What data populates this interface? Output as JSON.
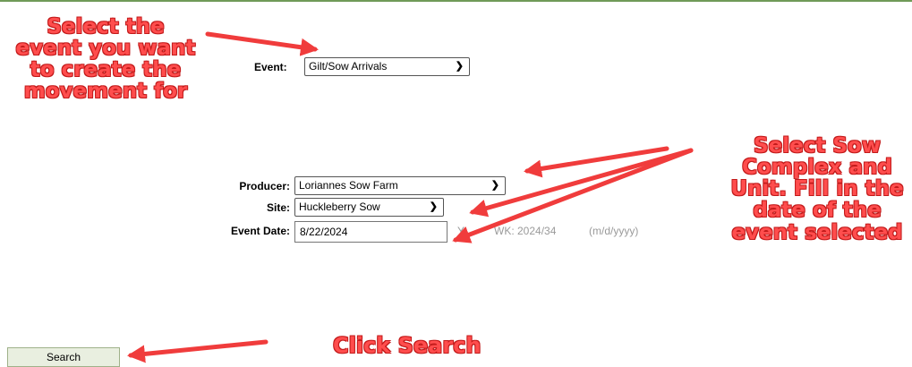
{
  "form": {
    "event_label": "Event:",
    "event_value": "Gilt/Sow Arrivals",
    "producer_label": "Producer:",
    "producer_value": "Loriannes Sow Farm",
    "site_label": "Site:",
    "site_value": "Huckleberry Sow",
    "event_date_label": "Event Date:",
    "event_date_value": "8/22/2024",
    "yearweek_prefix": "Y",
    "yearweek_value": "WK: 2024/34",
    "date_format_hint": "(m/d/yyyy)",
    "search_label": "Search"
  },
  "annotations": {
    "select_event": [
      "Select the",
      "event you want",
      "to create the",
      "movement for"
    ],
    "select_sow": [
      "Select Sow",
      "Complex and",
      "Unit. Fill in the",
      "date of the",
      "event selected"
    ],
    "click_search": "Click Search"
  },
  "colors": {
    "annotation_red": "#ff4d4d",
    "top_rule_green": "#6f9a58",
    "search_button_bg": "#e9efe0"
  }
}
